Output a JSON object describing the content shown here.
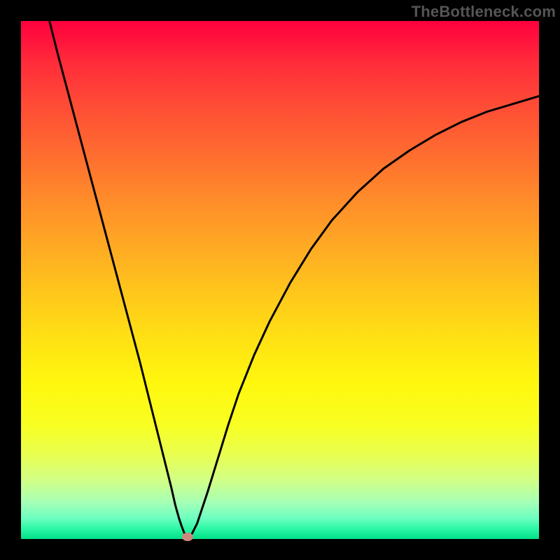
{
  "watermark": "TheBottleneck.com",
  "chart_data": {
    "type": "line",
    "title": "",
    "xlabel": "",
    "ylabel": "",
    "xlim": [
      0,
      100
    ],
    "ylim": [
      0,
      100
    ],
    "x": [
      5.5,
      7,
      9,
      11,
      13,
      15,
      17,
      19,
      21,
      23,
      25,
      26.5,
      28,
      29,
      29.8,
      30.5,
      31,
      31.5,
      32.1,
      33,
      34,
      36,
      38,
      40,
      42,
      45,
      48,
      52,
      56,
      60,
      65,
      70,
      75,
      80,
      85,
      90,
      95,
      100
    ],
    "y": [
      100,
      94,
      86.5,
      79,
      71.5,
      64,
      56.5,
      49,
      41.5,
      34,
      26,
      20,
      14,
      10,
      6.5,
      4,
      2.5,
      1.2,
      0.4,
      1.0,
      3,
      9,
      15.5,
      22,
      28,
      35.5,
      42,
      49.5,
      56,
      61.5,
      67,
      71.5,
      75,
      78,
      80.5,
      82.5,
      84,
      85.5
    ],
    "minimum_marker": {
      "x": 32.1,
      "y": 0.4
    },
    "background_gradient": "rainbow red-to-green (vertical)",
    "frame_color": "#000000"
  }
}
